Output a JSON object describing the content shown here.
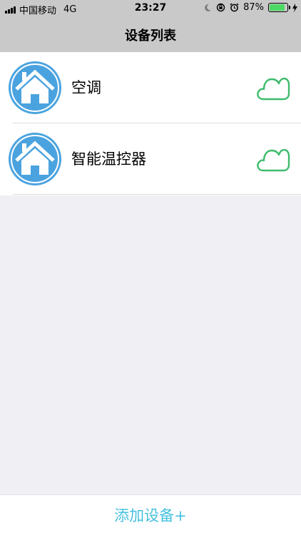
{
  "status_bar": {
    "carrier": "中国移动",
    "network": "4G",
    "time": "23:27",
    "battery_percent": "87%",
    "battery_level": 0.87,
    "icons": [
      "signal-icon",
      "moon-icon",
      "orientation-lock-icon",
      "alarm-icon",
      "battery-icon",
      "charging-icon"
    ]
  },
  "nav": {
    "title": "设备列表"
  },
  "devices": [
    {
      "name": "空调",
      "icon": "home-icon",
      "status_icon": "cloud-icon"
    },
    {
      "name": "智能温控器",
      "icon": "home-icon",
      "status_icon": "cloud-icon"
    }
  ],
  "bottom": {
    "add_label": "添加设备+"
  },
  "colors": {
    "nav_bg": "#c9c9c9",
    "page_bg": "#efeff4",
    "avatar_blue": "#4aa3df",
    "cloud_green": "#3dbb6c",
    "add_text": "#45c1e0",
    "battery_green": "#4cd964"
  }
}
